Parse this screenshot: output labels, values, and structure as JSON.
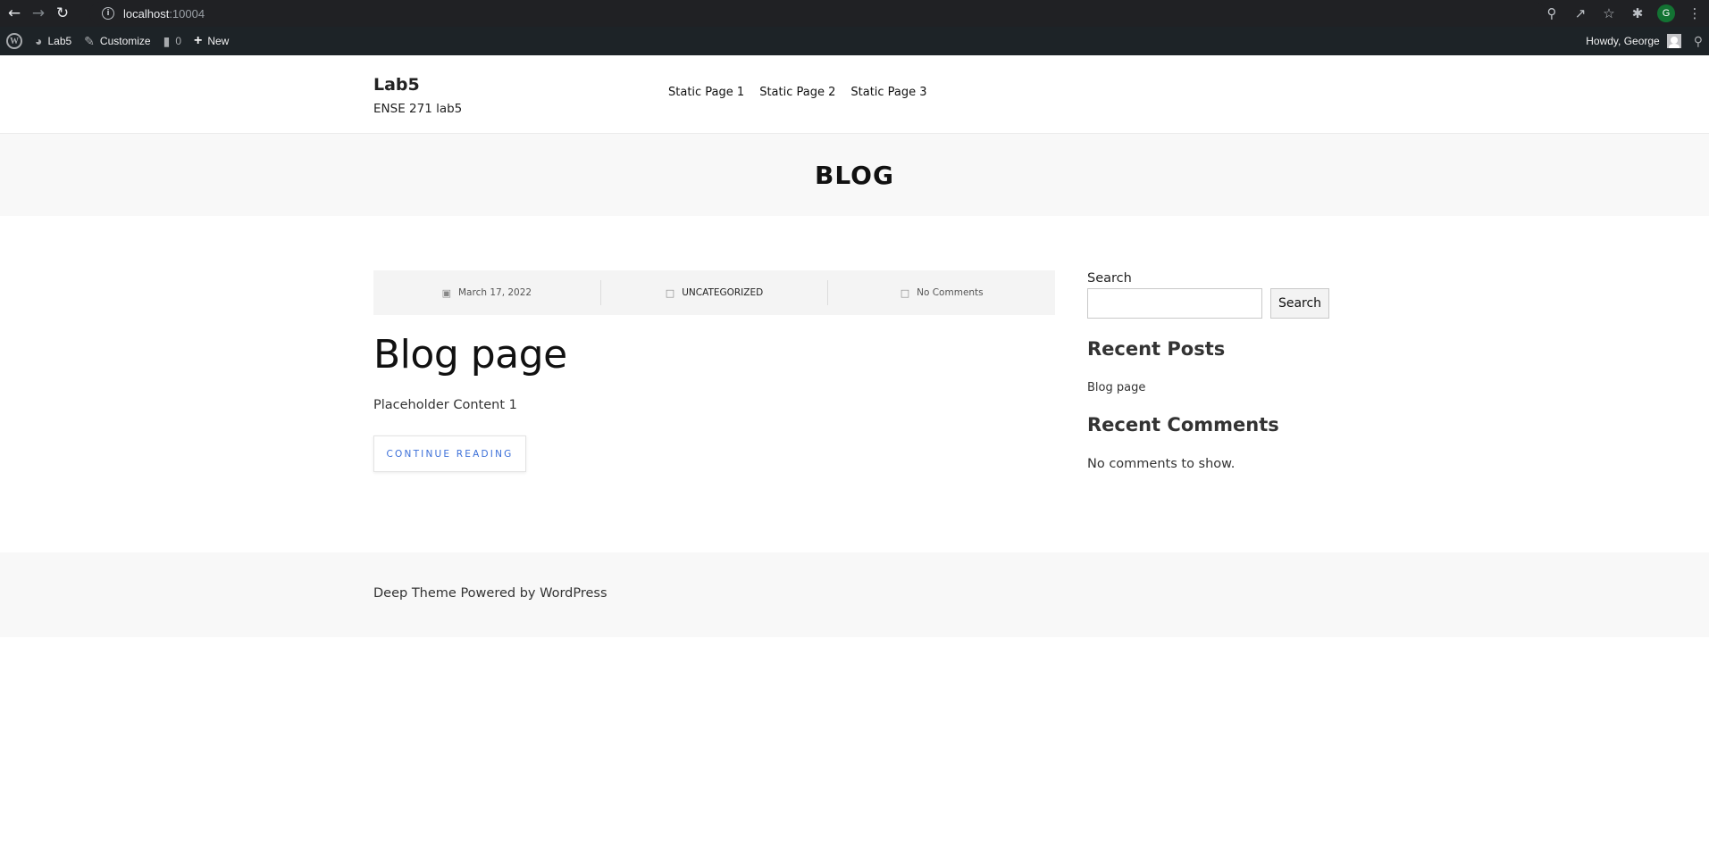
{
  "browser": {
    "url_host": "localhost",
    "url_port": ":10004",
    "profile_initial": "G"
  },
  "admin_bar": {
    "site_name": "Lab5",
    "customize": "Customize",
    "comments_count": "0",
    "new_label": "New",
    "greeting": "Howdy, George"
  },
  "header": {
    "site_title": "Lab5",
    "tagline": "ENSE 271 lab5",
    "nav": [
      "Static Page 1",
      "Static Page 2",
      "Static Page 3"
    ]
  },
  "page": {
    "title": "BLOG"
  },
  "post": {
    "date": "March 17, 2022",
    "category": "UNCATEGORIZED",
    "comments": "No Comments",
    "title": "Blog page",
    "excerpt": "Placeholder Content 1",
    "continue_label": "CONTINUE READING"
  },
  "sidebar": {
    "search_label": "Search",
    "search_button": "Search",
    "recent_posts_title": "Recent Posts",
    "recent_posts": [
      "Blog page"
    ],
    "recent_comments_title": "Recent Comments",
    "no_comments": "No comments to show."
  },
  "footer": {
    "text": "Deep Theme Powered by WordPress"
  },
  "colors": {
    "chrome_bg": "#202124",
    "admin_bar_bg": "#1d2327",
    "band_bg": "#f8f8f8",
    "link_blue": "#3b6fd8"
  }
}
